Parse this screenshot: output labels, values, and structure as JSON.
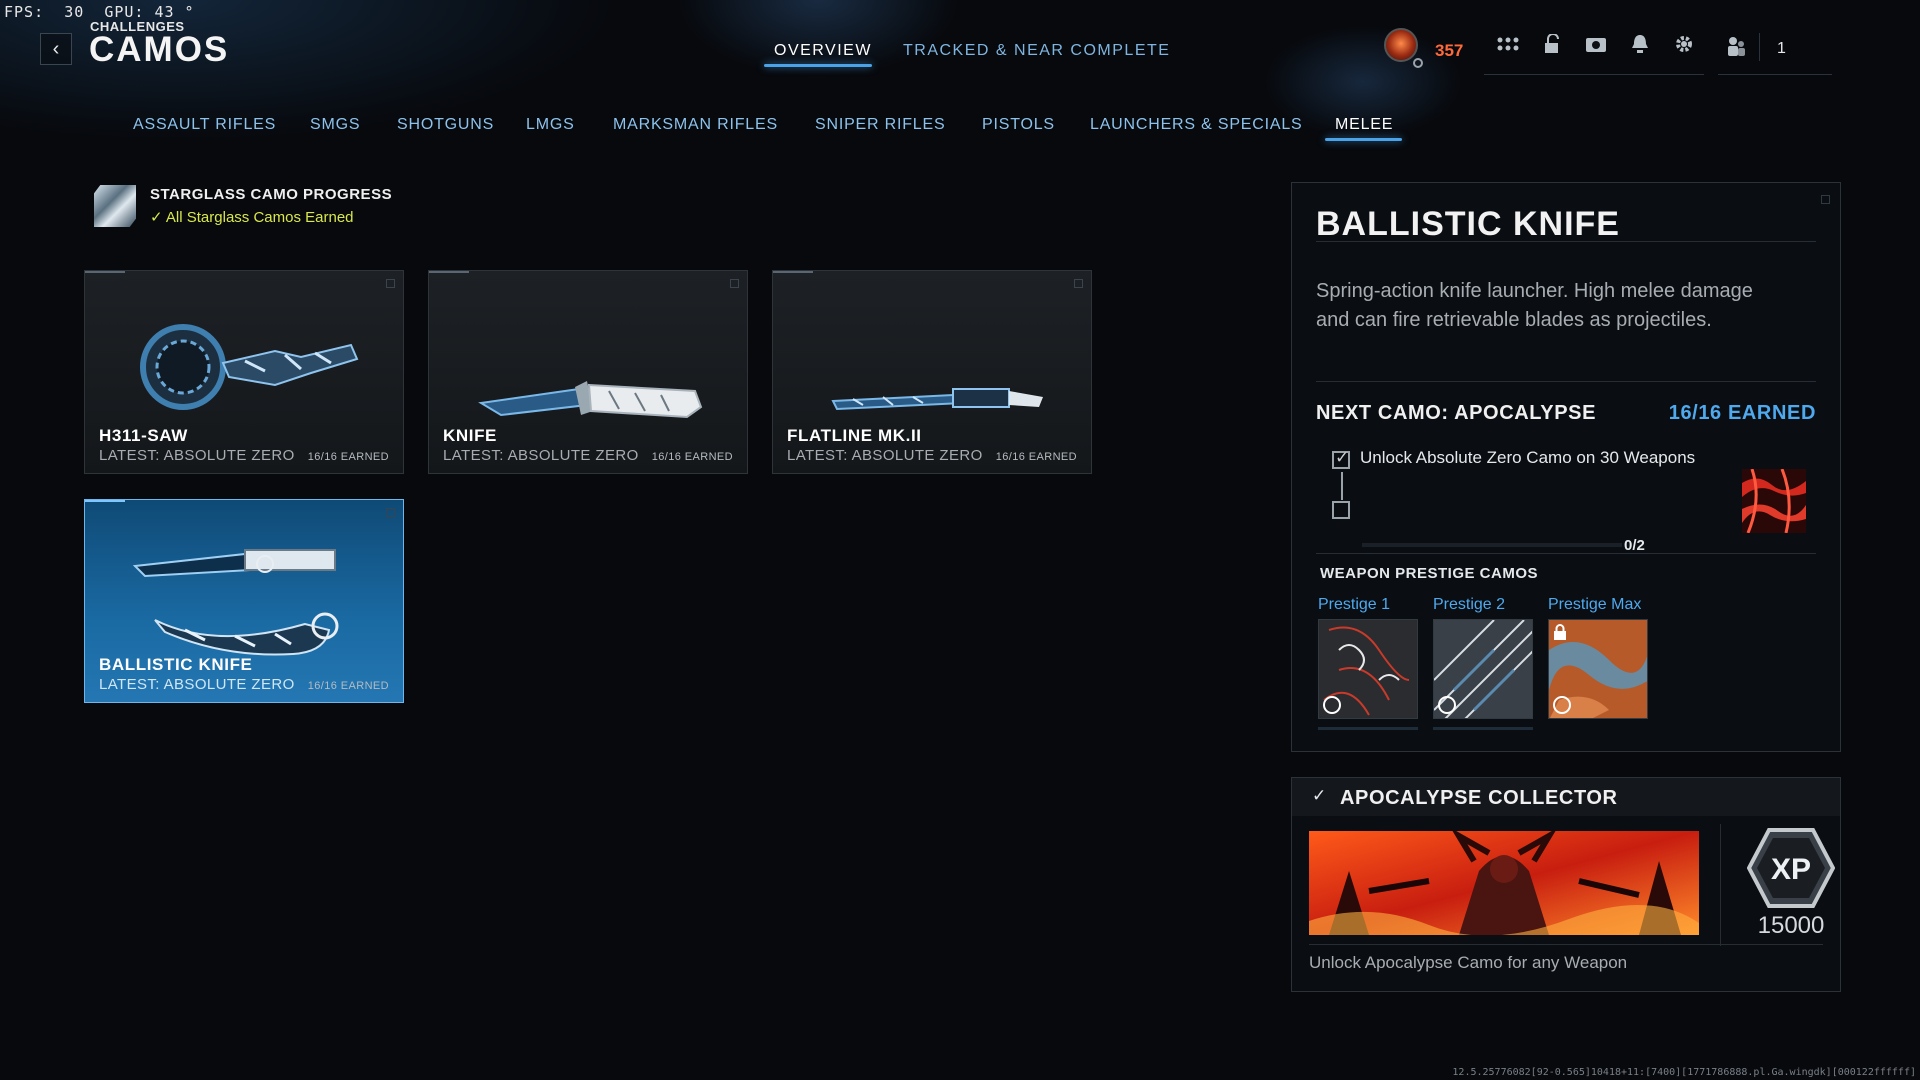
{
  "debug": {
    "fps_label": "FPS:",
    "fps_value": "30",
    "gpu_label": "GPU:",
    "gpu_value": "43"
  },
  "header": {
    "breadcrumb": "CHALLENGES",
    "title": "CAMOS"
  },
  "top_tabs": [
    {
      "label": "OVERVIEW",
      "active": true
    },
    {
      "label": "TRACKED & NEAR COMPLETE",
      "active": false
    }
  ],
  "hud": {
    "points": "357",
    "party_count": "1"
  },
  "categories": [
    {
      "label": "ASSAULT RIFLES",
      "active": false
    },
    {
      "label": "SMGS",
      "active": false
    },
    {
      "label": "SHOTGUNS",
      "active": false
    },
    {
      "label": "LMGS",
      "active": false
    },
    {
      "label": "MARKSMAN RIFLES",
      "active": false
    },
    {
      "label": "SNIPER RIFLES",
      "active": false
    },
    {
      "label": "PISTOLS",
      "active": false
    },
    {
      "label": "LAUNCHERS & SPECIALS",
      "active": false
    },
    {
      "label": "MELEE",
      "active": true
    }
  ],
  "starglass": {
    "title": "STARGLASS CAMO PROGRESS",
    "status": "All Starglass Camos Earned"
  },
  "weapons": [
    {
      "name": "H311-SAW",
      "latest": "LATEST: ABSOLUTE ZERO",
      "earned": "16/16 EARNED",
      "selected": false
    },
    {
      "name": "KNIFE",
      "latest": "LATEST: ABSOLUTE ZERO",
      "earned": "16/16 EARNED",
      "selected": false
    },
    {
      "name": "FLATLINE MK.II",
      "latest": "LATEST: ABSOLUTE ZERO",
      "earned": "16/16 EARNED",
      "selected": false
    },
    {
      "name": "BALLISTIC KNIFE",
      "latest": "LATEST: ABSOLUTE ZERO",
      "earned": "16/16 EARNED",
      "selected": true
    }
  ],
  "details": {
    "title": "BALLISTIC KNIFE",
    "description": "Spring-action knife launcher. High melee damage and can fire retrievable blades as projectiles.",
    "next_camo": "NEXT CAMO: APOCALYPSE",
    "next_earned": "16/16 EARNED",
    "requirement": "Unlock Absolute Zero Camo on 30 Weapons",
    "requirement_progress": "0/2",
    "prestige_heading": "WEAPON PRESTIGE CAMOS",
    "prestige": [
      {
        "label": "Prestige 1",
        "locked": false
      },
      {
        "label": "Prestige 2",
        "locked": false
      },
      {
        "label": "Prestige Max",
        "locked": true
      }
    ]
  },
  "collector": {
    "title": "APOCALYPSE COLLECTOR",
    "xp_badge": "XP",
    "xp_value": "15000",
    "description": "Unlock Apocalypse Camo for any Weapon"
  },
  "build_string": "12.5.25776082[92-0.565]10418+11:[7400][1771786888.pl.Ga.wingdk][000122ffffff]",
  "colors": {
    "accent": "#4ea9ee",
    "points": "#ff6a3a",
    "starglass": "#d9e84a"
  }
}
